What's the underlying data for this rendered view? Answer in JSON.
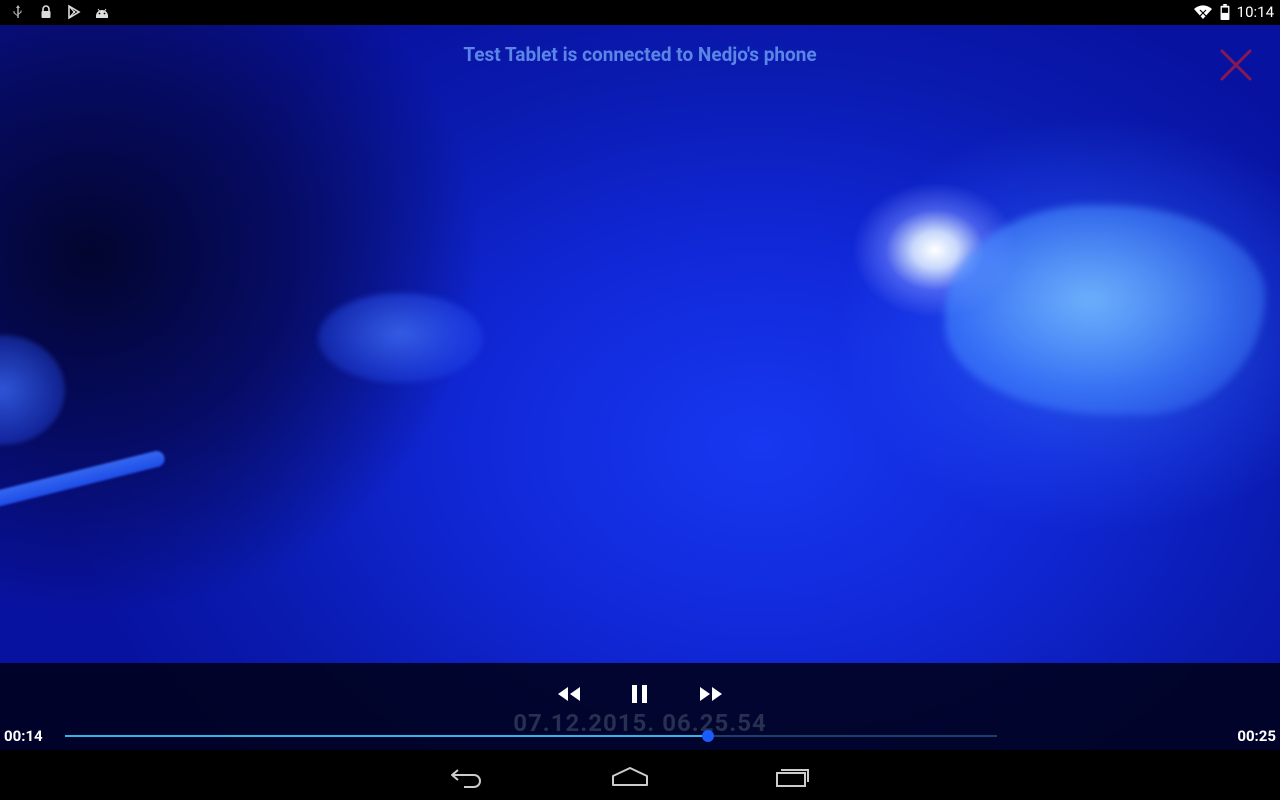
{
  "status_bar": {
    "left_icons": [
      "usb-icon",
      "lock-icon",
      "play-store-icon",
      "android-debug-icon"
    ],
    "right_icons": [
      "wifi-icon",
      "battery-icon"
    ],
    "time": "10:14"
  },
  "video": {
    "cast_message": "Test Tablet is connected to Nedjo's phone",
    "close_icon": "close-icon",
    "colors": {
      "cast_text": "#5b86e6",
      "close": "#b01a3a"
    }
  },
  "controls": {
    "rewind_icon": "rewind-icon",
    "pause_icon": "pause-icon",
    "fast_forward_icon": "fast-forward-icon",
    "timestamp": "07.12.2015. 06.25.54",
    "elapsed": "00:14",
    "duration": "00:25",
    "progress_percent": 69,
    "colors": {
      "progress": "#33b5e5",
      "thumb": "#1a5cff"
    }
  },
  "nav_bar": {
    "back_icon": "back-icon",
    "home_icon": "home-icon",
    "recents_icon": "recents-icon"
  }
}
